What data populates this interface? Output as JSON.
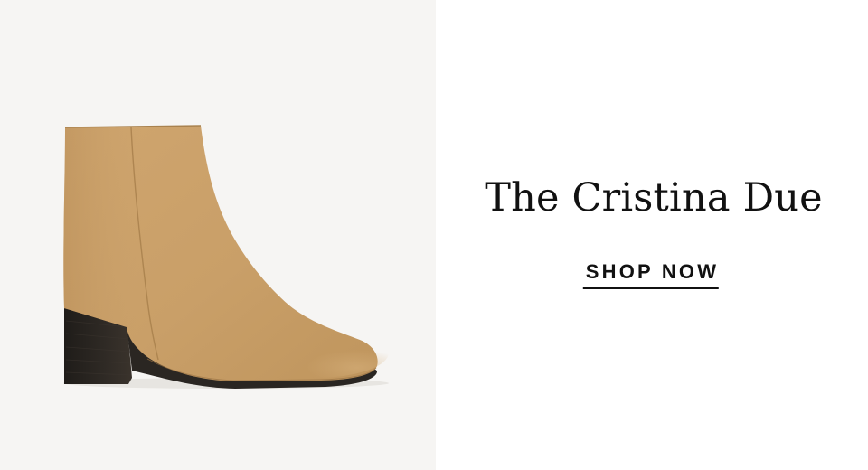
{
  "banner": {
    "headline": "The Cristina Due",
    "cta_label": "SHOP NOW"
  },
  "product_image": {
    "icon": "ankle-boot-image",
    "boot_color": "#c9a26a",
    "heel_color": "#2a2622",
    "background_color": "#f6f5f3"
  }
}
